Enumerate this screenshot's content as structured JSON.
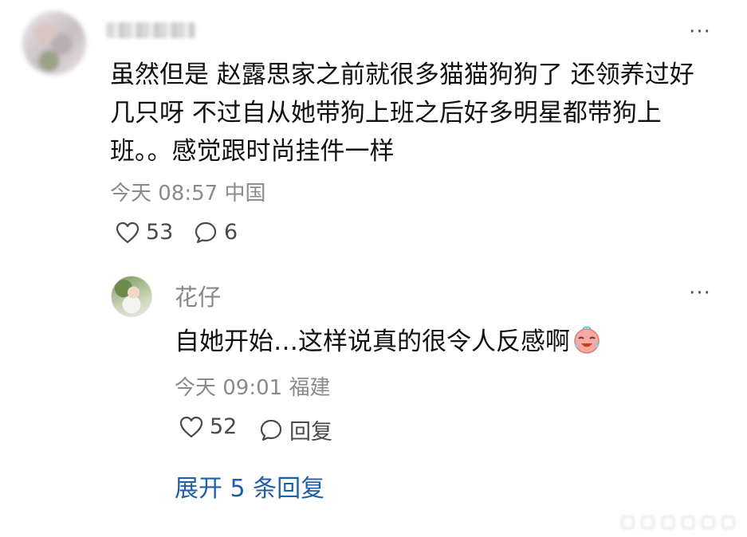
{
  "comment": {
    "text": "虽然但是 赵露思家之前就很多猫猫狗狗了 还领养过好几只呀 不过自从她带狗上班之后好多明星都带狗上班。。感觉跟时尚挂件一样",
    "time": "今天 08:57",
    "location": "中国",
    "likes": "53",
    "comments": "6",
    "more_label": "···"
  },
  "reply": {
    "username": "花仔",
    "text": "自她开始…这样说真的很令人反感啊",
    "time": "今天 09:01",
    "location": "福建",
    "likes": "52",
    "reply_label": "回复",
    "more_label": "···"
  },
  "expand_label": "展开 5 条回复",
  "icons": {
    "like": "heart-outline-icon",
    "comment": "speech-bubble-icon",
    "emoji": "crying-laughing-emoji-icon"
  },
  "colors": {
    "link": "#1f5fa8",
    "meta": "#8a8a8a"
  }
}
